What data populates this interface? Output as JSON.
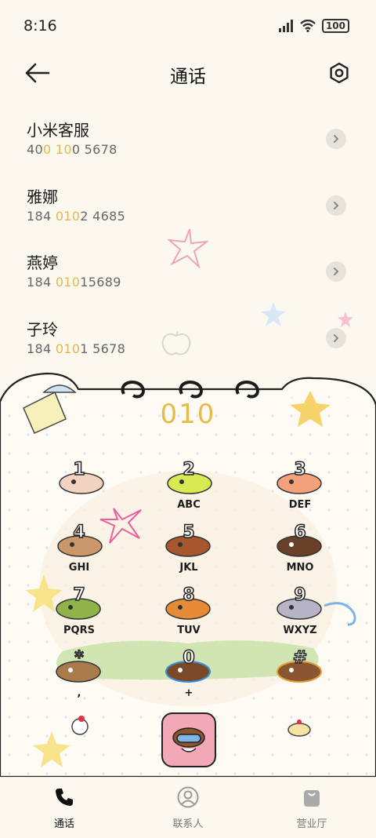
{
  "status": {
    "time": "8:16",
    "battery": "100"
  },
  "header": {
    "title": "通话"
  },
  "calls": [
    {
      "name": "小米客服",
      "num_pre": "40",
      "num_h1": "0",
      "num_mid": " ",
      "num_h2": "10",
      "num_post": "0 5678"
    },
    {
      "name": "雅娜",
      "num_pre": "184 ",
      "num_h1": "010",
      "num_mid": "",
      "num_h2": "",
      "num_post": "2 4685"
    },
    {
      "name": "燕婷",
      "num_pre": "184 ",
      "num_h1": "010",
      "num_mid": "",
      "num_h2": "",
      "num_post": "15689"
    },
    {
      "name": "子玲",
      "num_pre": "184 ",
      "num_h1": "010",
      "num_mid": "",
      "num_h2": "",
      "num_post": "1 5678"
    }
  ],
  "dialer": {
    "display": "010",
    "keys": [
      {
        "char": "1",
        "letters": ""
      },
      {
        "char": "2",
        "letters": "ABC"
      },
      {
        "char": "3",
        "letters": "DEF"
      },
      {
        "char": "4",
        "letters": "GHI"
      },
      {
        "char": "5",
        "letters": "JKL"
      },
      {
        "char": "6",
        "letters": "MNO"
      },
      {
        "char": "7",
        "letters": "PQRS"
      },
      {
        "char": "8",
        "letters": "TUV"
      },
      {
        "char": "9",
        "letters": "WXYZ"
      },
      {
        "char": "*",
        "letters": ","
      },
      {
        "char": "0",
        "letters": "+"
      },
      {
        "char": "#",
        "letters": ""
      }
    ]
  },
  "nav": {
    "items": [
      {
        "label": "通话",
        "icon": "phone-icon"
      },
      {
        "label": "联系人",
        "icon": "contact-icon"
      },
      {
        "label": "营业厅",
        "icon": "bag-icon"
      }
    ]
  },
  "colors": {
    "accent": "#e6b84c",
    "background": "#fbf8ef",
    "call_button": "#f2a8b7"
  }
}
